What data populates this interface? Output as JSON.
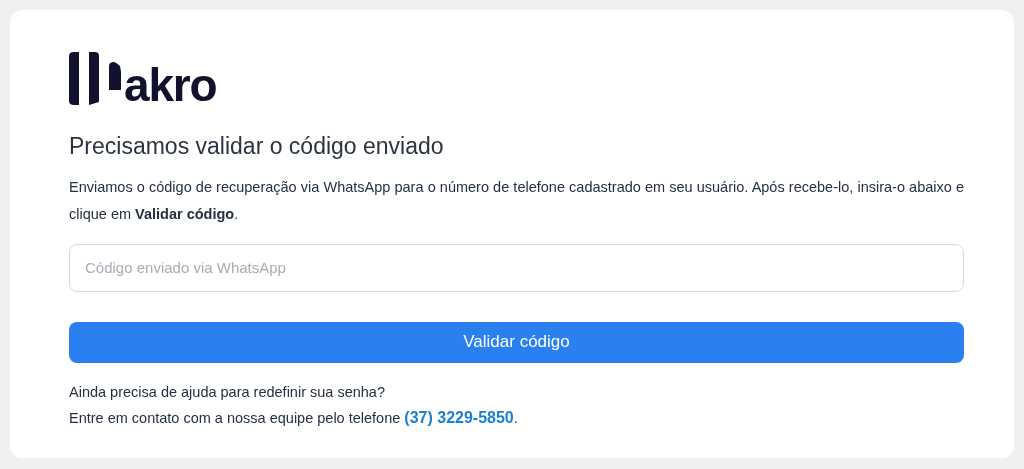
{
  "logo": {
    "text": "akro"
  },
  "title": "Precisamos validar o código enviado",
  "description": "Enviamos o código de recuperação via WhatsApp para o número de telefone cadastrado em seu usuário. Após recebe-lo, insira-o abaixo e clique em **Validar código**.",
  "code_field": {
    "placeholder": "Código enviado via WhatsApp"
  },
  "submit_button": "Validar código",
  "help": {
    "question": "Ainda precisa de ajuda para redefinir sua senha?",
    "contact_before": "Entre em contato com a nossa equipe pelo telefone",
    "phone": "(37) 3229-5850",
    "contact_after": "."
  }
}
